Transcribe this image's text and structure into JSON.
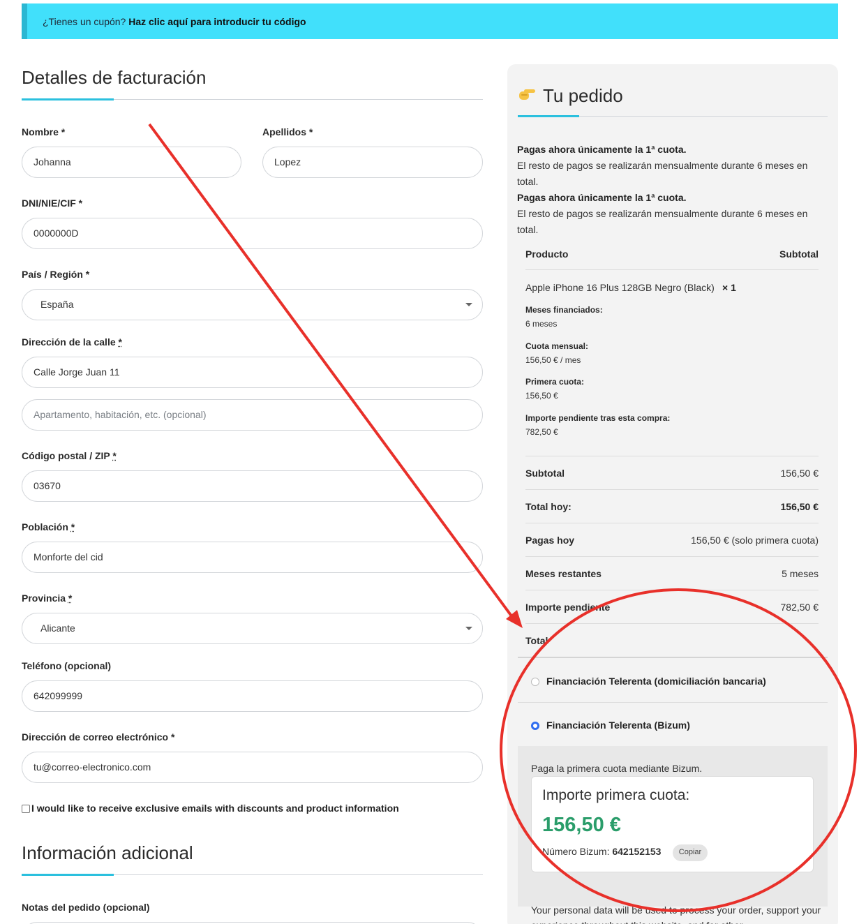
{
  "coupon": {
    "prefix": "¿Tienes un cupón?",
    "link": "Haz clic aquí para introducir tu código"
  },
  "billing": {
    "title": "Detalles de facturación",
    "fields": {
      "first_name": {
        "label": "Nombre *",
        "value": "Johanna"
      },
      "last_name": {
        "label": "Apellidos *",
        "value": "Lopez"
      },
      "dni": {
        "label": "DNI/NIE/CIF *",
        "value": "0000000D"
      },
      "country": {
        "label": "País / Región *",
        "value": "España"
      },
      "address": {
        "label": "Dirección de la calle",
        "value": "Calle Jorge Juan 11"
      },
      "address2": {
        "placeholder": "Apartamento, habitación, etc. (opcional)"
      },
      "postcode": {
        "label": "Código postal / ZIP",
        "value": "03670"
      },
      "city": {
        "label": "Población",
        "value": "Monforte del cid"
      },
      "province": {
        "label": "Provincia",
        "value": "Alicante"
      },
      "phone": {
        "label": "Teléfono (opcional)",
        "value": "642099999"
      },
      "email": {
        "label": "Dirección de correo electrónico *",
        "value": "tu@correo-electronico.com"
      }
    },
    "required_mark": "*",
    "newsletter": "I would like to receive exclusive emails with discounts and product information"
  },
  "additional": {
    "title": "Información adicional",
    "notes_label": "Notas del pedido (opcional)"
  },
  "order": {
    "title": "Tu pedido",
    "note1_bold": "Pagas ahora únicamente la 1ª cuota.",
    "note1_text": "El resto de pagos se realizarán mensualmente durante 6 meses en total.",
    "note2_bold": "Pagas ahora únicamente la 1ª cuota.",
    "note2_text": "El resto de pagos se realizarán mensualmente durante 6 meses en total.",
    "head_product": "Producto",
    "head_subtotal": "Subtotal",
    "product_name": "Apple iPhone 16 Plus 128GB Negro (Black)",
    "product_qty": "× 1",
    "meta": [
      {
        "k": "Meses financiados:",
        "v": "6 meses"
      },
      {
        "k": "Cuota mensual:",
        "v": "156,50 € / mes"
      },
      {
        "k": "Primera cuota:",
        "v": "156,50 €"
      },
      {
        "k": "Importe pendiente tras esta compra:",
        "v": "782,50 €"
      }
    ],
    "totals": [
      {
        "k": "Subtotal",
        "v": "156,50 €"
      },
      {
        "k": "Total hoy:",
        "v": "156,50 €"
      },
      {
        "k": "Pagas hoy",
        "v": "156,50 € (solo primera cuota)"
      },
      {
        "k": "Meses restantes",
        "v": "5 meses"
      },
      {
        "k": "Importe pendiente",
        "v": "782,50 €"
      },
      {
        "k": "Total",
        "v": ""
      }
    ],
    "payment_methods": [
      {
        "label": "Financiación Telerenta (domiciliación bancaria)",
        "selected": false
      },
      {
        "label": "Financiación Telerenta (Bizum)",
        "selected": true
      }
    ],
    "bizum": {
      "description": "Paga la primera cuota mediante Bizum.",
      "card_title": "Importe primera cuota:",
      "amount": "156,50 €",
      "number_label": "Número Bizum:",
      "number": "642152153",
      "copy_label": "Copiar"
    },
    "privacy": "Your personal data will be used to process your order, support your experience throughout this website, and for other"
  },
  "colors": {
    "accent": "#2bc0de",
    "banner": "#41e0fb",
    "amount": "#2a9d6a",
    "annotation": "#e8302a",
    "radio": "#2f6df0"
  },
  "icons": {
    "order_title": "pointing-hand-icon",
    "select": "chevron-down-icon"
  }
}
